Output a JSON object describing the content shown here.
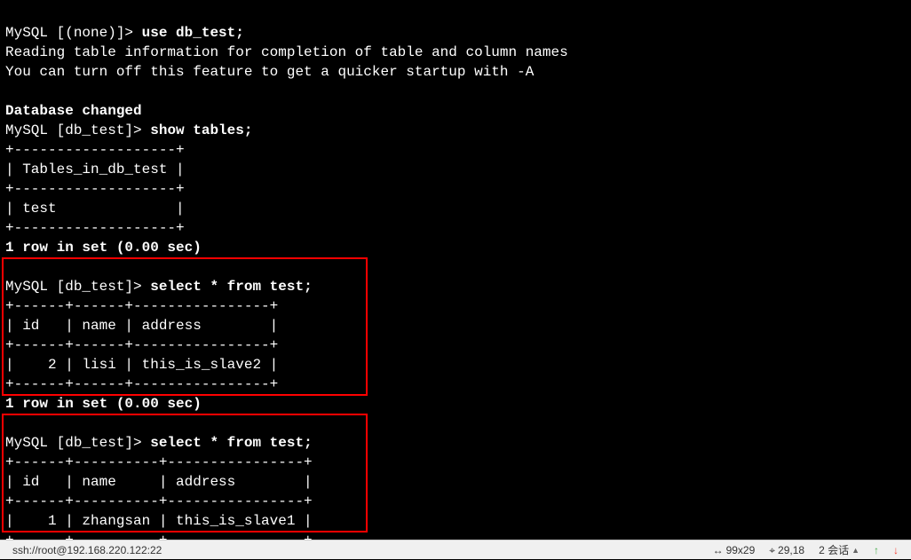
{
  "prompt_none": "MySQL [(none)]>",
  "prompt_db": "MySQL [db_test]>",
  "cmd_use": "use db_test;",
  "info1": "Reading table information for completion of table and column names",
  "info2": "You can turn off this feature to get a quicker startup with -A",
  "db_changed": "Database changed",
  "cmd_show": "show tables;",
  "tables_border": "+-------------------+",
  "tables_header": "| Tables_in_db_test |",
  "tables_row": "| test              |",
  "rows_1": "1 row in set (0.00 sec)",
  "cmd_select": "select * from test;",
  "t1_border": "+------+------+----------------+",
  "t1_header": "| id   | name | address        |",
  "t1_row": "|    2 | lisi | this_is_slave2 |",
  "t2_border": "+------+----------+----------------+",
  "t2_header": "| id   | name     | address        |",
  "t2_row": "|    1 | zhangsan | this_is_slave1 |",
  "status": {
    "conn": "ssh://root@192.168.220.122:22",
    "size": "99x29",
    "pos": "29,18",
    "sessions": "2 会话"
  }
}
